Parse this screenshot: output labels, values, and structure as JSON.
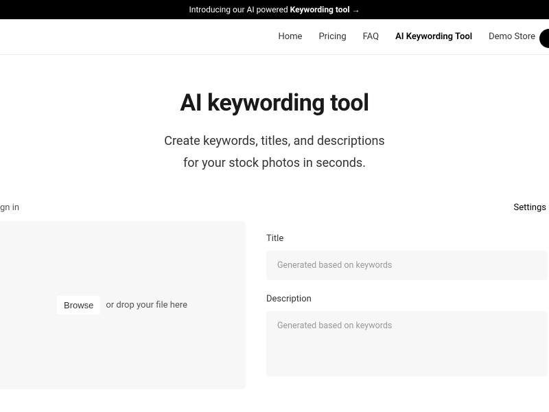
{
  "announcement": {
    "prefix": "Introducing our AI powered ",
    "bold": "Keywording tool →"
  },
  "nav": {
    "items": [
      {
        "label": "Home"
      },
      {
        "label": "Pricing"
      },
      {
        "label": "FAQ"
      },
      {
        "label": "AI Keywording Tool"
      },
      {
        "label": "Demo Store"
      }
    ]
  },
  "hero": {
    "title": "AI keywording tool",
    "subtitle_line1": "Create keywords, titles, and descriptions",
    "subtitle_line2": "for your stock photos in seconds."
  },
  "toolbar": {
    "left": "gn in",
    "right": "Settings"
  },
  "upload": {
    "browse_label": "Browse",
    "drop_text": "or drop your file here"
  },
  "output": {
    "title_label": "Title",
    "title_placeholder": "Generated based on keywords",
    "description_label": "Description",
    "description_placeholder": "Generated based on keywords"
  }
}
